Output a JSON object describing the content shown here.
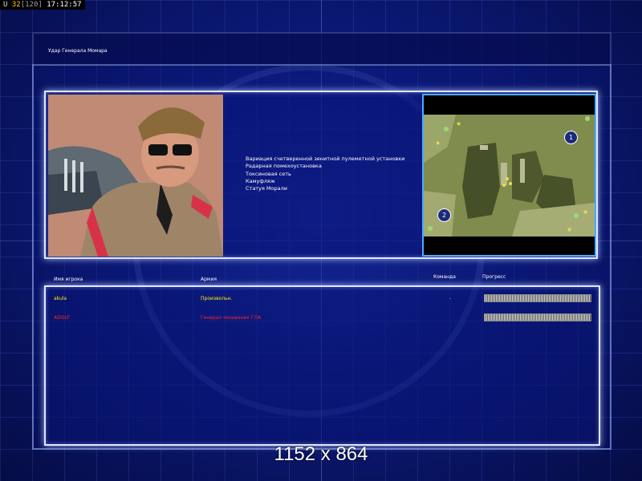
{
  "status_bar": {
    "prefix": "U",
    "fps": "32",
    "fps_cap": "[120]",
    "time": "17:12:57"
  },
  "screen_title": "Удар Генерала Момара",
  "general": {
    "units": [
      "Вариация счетверенной зенитной пулеметной установки",
      "Радарная помехоустановка",
      "Токсиновая сеть",
      "Камуфляж",
      "Статуя Морали"
    ]
  },
  "minimap": {
    "markers": [
      "1",
      "2"
    ]
  },
  "table": {
    "headers": {
      "player": "Имя игрока",
      "army": "Армия",
      "team": "Команда",
      "progress": "Прогресс"
    },
    "rows": [
      {
        "player": "akula",
        "army": "Произвольн.",
        "team": "-",
        "color": "#ffee00"
      },
      {
        "player": "ADOLF",
        "army": "Генерал мошенник ГЛА",
        "team": "",
        "color": "#ff2424"
      }
    ]
  },
  "resolution_label": "1152 x 864",
  "colors": {
    "panel_border": "#dfe6ff",
    "minimap_border": "#4fa9ff",
    "player1": "#ffee00",
    "player2": "#ff2424"
  }
}
